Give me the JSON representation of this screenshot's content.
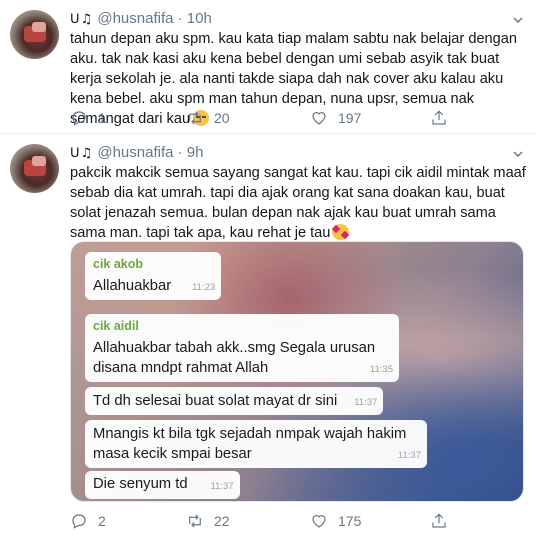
{
  "tweets": [
    {
      "icons": "ᑌ♫",
      "username": "@husnafifa",
      "age": "· 10h",
      "text": "tahun depan aku spm. kau kata tiap malam sabtu nak belajar dengan aku. tak nak kasi aku kena bebel dengan umi sebab asyik tak buat kerja sekolah je. ala nanti takde siapa dah nak cover aku kalau aku kena bebel. aku spm man tahun depan, nuna upsr, semua nak semangat dari kau",
      "emoji": "pensive-face-emoji",
      "replies": "1",
      "retweets": "20",
      "likes": "197"
    },
    {
      "icons": "ᑌ♫",
      "username": "@husnafifa",
      "age": "· 9h",
      "text": "pakcik makcik semua sayang sangat kat kau. tapi cik aidil mintak maaf sebab dia kat umrah. tapi dia ajak orang kat sana doakan kau, buat solat jenazah semua. bulan depan nak ajak kau buat umrah sama sama man. tapi tak apa, kau rehat je tau",
      "emoji": "smiling-face-with-hearts-emoji",
      "replies": "2",
      "retweets": "22",
      "likes": "175",
      "chat": [
        {
          "sender": "cik akob",
          "message": "Allahuakbar",
          "time": "11:23"
        },
        {
          "sender": "cik aidil",
          "message": "Allahuakbar tabah akk..smg Segala urusan disana mndpt rahmat Allah",
          "time": "11:35"
        },
        {
          "sender": "",
          "message": "Td dh selesai buat solat mayat dr sini",
          "time": "11:37"
        },
        {
          "sender": "",
          "message": "Mnangis kt bila tgk sejadah nmpak wajah hakim masa kecik smpai besar",
          "time": "11:37"
        },
        {
          "sender": "",
          "message": "Die senyum td",
          "time": "11:37"
        }
      ]
    }
  ],
  "colors": {
    "muted": "#657786",
    "text": "#14171a",
    "divider": "#e6ecf0",
    "sender": "#6aa83c"
  }
}
